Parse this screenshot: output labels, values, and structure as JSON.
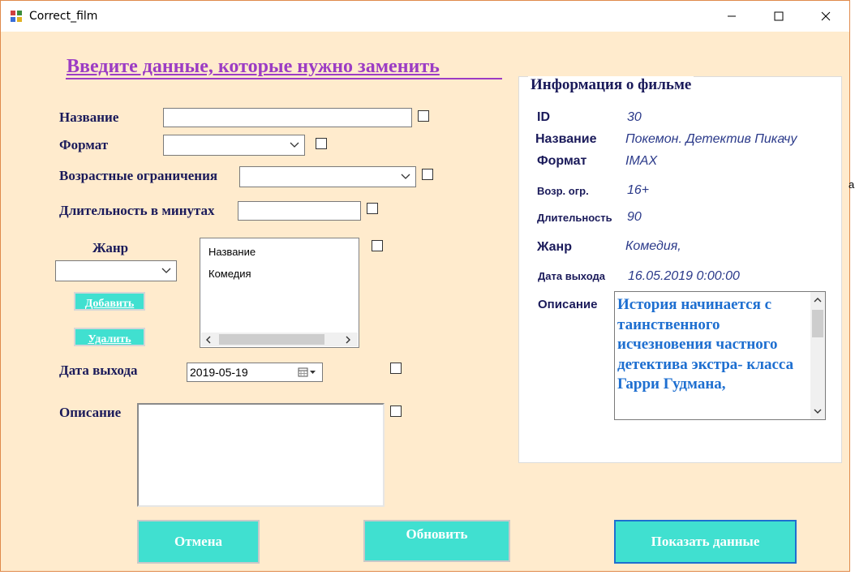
{
  "window": {
    "title": "Correct_film"
  },
  "heading": "Введите данные, которые нужно заменить",
  "form": {
    "name_label": "Название",
    "name_value": "",
    "format_label": "Формат",
    "format_value": "",
    "age_label": "Возрастные ограничения",
    "age_value": "",
    "duration_label": "Длительность в минутах",
    "duration_value": "",
    "genre_label": "Жанр",
    "genre_value": "",
    "genre_list": [
      "Название",
      "Комедия"
    ],
    "add_button": "Добавить",
    "remove_button": "Удалить",
    "release_label": "Дата выхода",
    "release_value": "2019-05-19",
    "description_label": "Описание",
    "description_value": ""
  },
  "buttons": {
    "cancel": "Отмена",
    "update": "Обновить",
    "show": "Показать данные"
  },
  "info": {
    "title": "Информация о фильме",
    "id_label": "ID",
    "id_value": "30",
    "name_label": "Название",
    "name_value": "Покемон. Детектив Пикачу",
    "format_label": "Формат",
    "format_value": "IMAX",
    "age_label": "Возр. огр.",
    "age_value": "16+",
    "duration_label": "Длительность",
    "duration_value": "90",
    "genre_label": "Жанр",
    "genre_value": "Комедия,",
    "release_label": "Дата выхода",
    "release_value": "16.05.2019 0:00:00",
    "description_label": "Описание",
    "description_value": "История начинается с таинственного исчезновения частного детектива экстра- класса Гарри Гудмана,"
  },
  "edge_text": "a",
  "colors": {
    "background": "#ffebcd",
    "heading": "#9c3cc4",
    "label": "#1a1a5a",
    "button": "#40e0d0",
    "info_value": "#2b3a8a",
    "description_text": "#1e6fd0"
  }
}
